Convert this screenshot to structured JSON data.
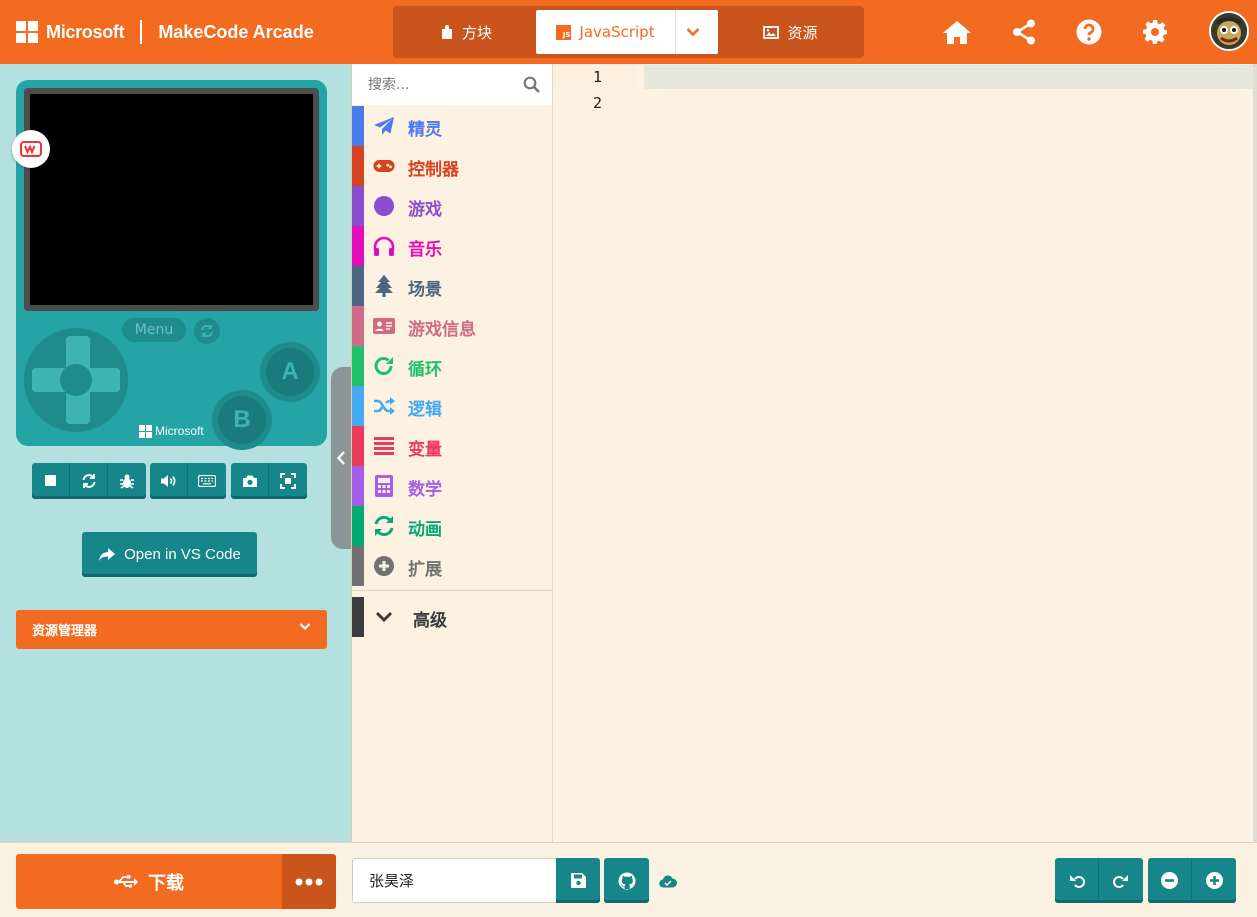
{
  "header": {
    "brand_company": "Microsoft",
    "brand_app": "MakeCode Arcade",
    "tabs": {
      "blocks_label": "方块",
      "javascript_label": "JavaScript",
      "assets_label": "资源"
    },
    "js_badge": "JS",
    "icons": [
      "home-icon",
      "share-icon",
      "help-icon",
      "settings-icon"
    ]
  },
  "simulator": {
    "menu_label": "Menu",
    "button_a": "A",
    "button_b": "B",
    "device_brand": "Microsoft",
    "toolbar_icons": [
      "stop-icon",
      "restart-icon",
      "debug-icon",
      "sound-icon",
      "keyboard-icon",
      "screenshot-icon",
      "fullscreen-icon"
    ],
    "open_vscode_label": "Open in VS Code",
    "explorer_label": "资源管理器"
  },
  "toolbox": {
    "search_placeholder": "搜索...",
    "categories": [
      {
        "label": "精灵",
        "color": "#4b7bec",
        "icon": "paper-plane-icon"
      },
      {
        "label": "控制器",
        "color": "#d54322",
        "icon": "gamepad-icon"
      },
      {
        "label": "游戏",
        "color": "#8b4dd0",
        "icon": "circle-icon"
      },
      {
        "label": "音乐",
        "color": "#e20fb8",
        "icon": "headphones-icon"
      },
      {
        "label": "场景",
        "color": "#4b6584",
        "icon": "tree-icon"
      },
      {
        "label": "游戏信息",
        "color": "#cf6a87",
        "icon": "id-card-icon"
      },
      {
        "label": "循环",
        "color": "#20bf6b",
        "icon": "redo-icon"
      },
      {
        "label": "逻辑",
        "color": "#45aaf2",
        "icon": "random-icon"
      },
      {
        "label": "变量",
        "color": "#eb3b5a",
        "icon": "list-icon"
      },
      {
        "label": "数学",
        "color": "#a55eea",
        "icon": "calculator-icon"
      },
      {
        "label": "动画",
        "color": "#03aa74",
        "icon": "refresh-icon"
      },
      {
        "label": "扩展",
        "color": "#717171",
        "icon": "plus-circle-icon"
      }
    ],
    "advanced_label": "高级"
  },
  "editor": {
    "line_numbers": [
      "1",
      "2"
    ]
  },
  "footer": {
    "download_label": "下载",
    "project_name": "张昊泽"
  }
}
